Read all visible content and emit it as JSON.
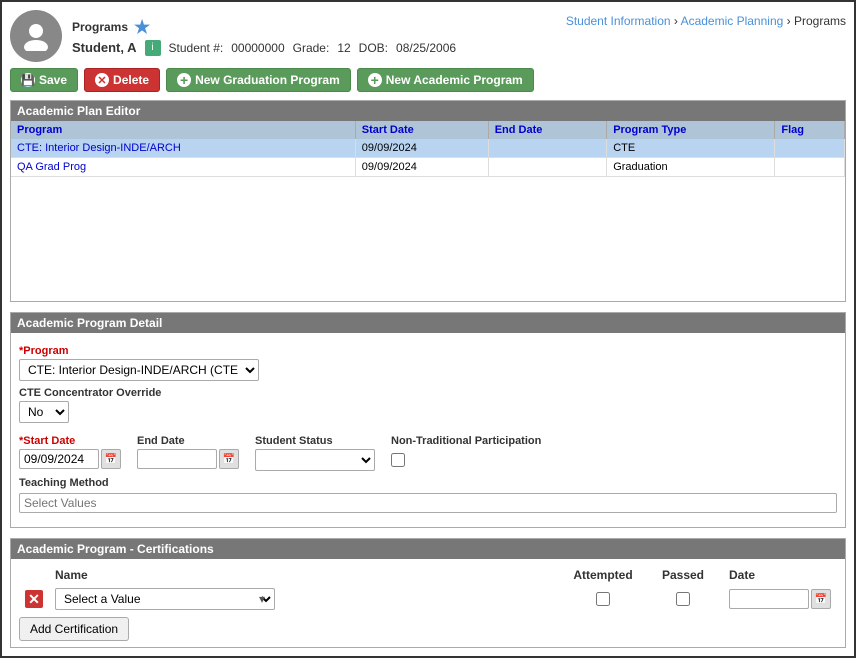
{
  "header": {
    "title": "Programs",
    "star": "★",
    "student_name": "Student, A",
    "student_number_label": "Student #:",
    "student_number": "00000000",
    "grade_label": "Grade:",
    "grade": "12",
    "dob_label": "DOB:",
    "dob": "08/25/2006"
  },
  "breadcrumb": {
    "student_information": "Student Information",
    "academic_planning": "Academic Planning",
    "programs": "Programs",
    "separator": "›"
  },
  "toolbar": {
    "save_label": "Save",
    "delete_label": "Delete",
    "new_grad_label": "New Graduation Program",
    "new_academic_label": "New Academic Program"
  },
  "plan_editor": {
    "section_title": "Academic Plan Editor",
    "columns": [
      "Program",
      "Start Date",
      "End Date",
      "Program Type",
      "Flag"
    ],
    "rows": [
      {
        "program": "CTE: Interior Design-INDE/ARCH",
        "start_date": "09/09/2024",
        "end_date": "",
        "program_type": "CTE",
        "flag": "",
        "selected": true
      },
      {
        "program": "QA Grad Prog",
        "start_date": "09/09/2024",
        "end_date": "",
        "program_type": "Graduation",
        "flag": "",
        "selected": false
      }
    ]
  },
  "program_detail": {
    "section_title": "Academic Program Detail",
    "program_label": "*Program",
    "program_value": "CTE: Interior Design-INDE/ARCH (CTE Category",
    "override_label": "CTE Concentrator Override",
    "override_value": "No",
    "start_date_label": "*Start Date",
    "start_date_value": "09/09/2024",
    "end_date_label": "End Date",
    "end_date_value": "",
    "student_status_label": "Student Status",
    "ntp_label": "Non-Traditional Participation",
    "teaching_method_label": "Teaching Method",
    "teaching_method_placeholder": "Select Values"
  },
  "certifications": {
    "section_title": "Academic Program - Certifications",
    "col_name": "Name",
    "col_attempted": "Attempted",
    "col_passed": "Passed",
    "col_date": "Date",
    "name_placeholder": "Select a Value",
    "add_btn_label": "Add Certification"
  }
}
